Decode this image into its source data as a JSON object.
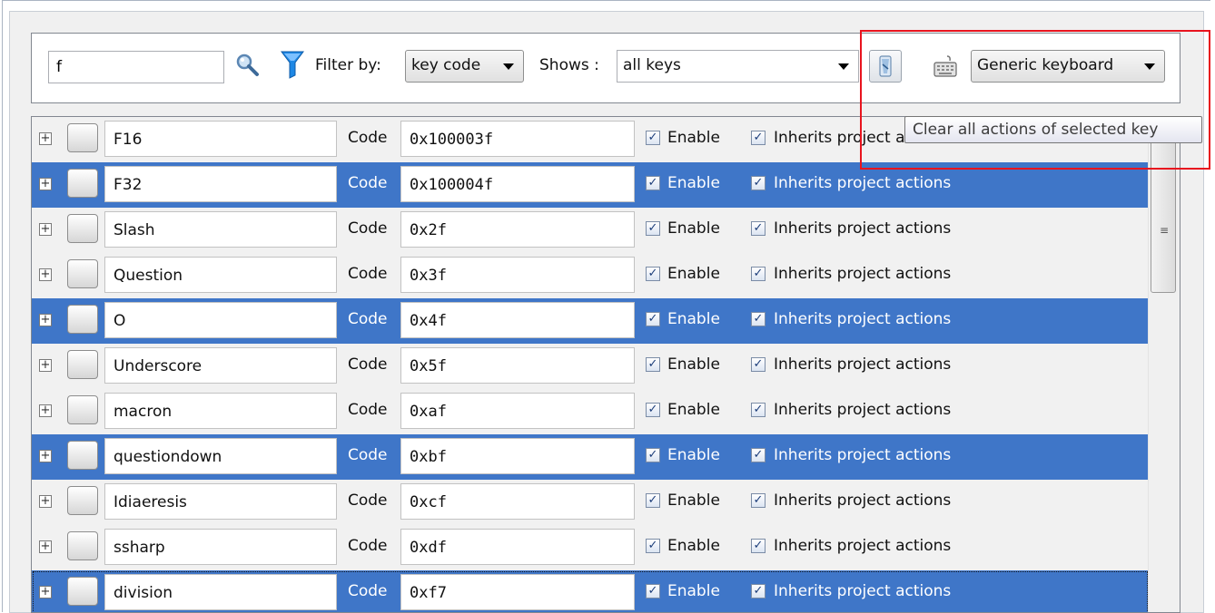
{
  "toolbar": {
    "search_value": "f",
    "filter_label": "Filter by:",
    "filter_selected": "key code",
    "shows_label": "Shows :",
    "shows_selected": "all keys",
    "keyboard_selected": "Generic keyboard"
  },
  "tooltip": {
    "text": "Clear all actions of selected key"
  },
  "rows": [
    {
      "name": "F16",
      "code_label": "Code",
      "code": "0x100003f",
      "enable_label": "Enable",
      "inherit_label": "Inherits project actions",
      "selected": false
    },
    {
      "name": "F32",
      "code_label": "Code",
      "code": "0x100004f",
      "enable_label": "Enable",
      "inherit_label": "Inherits project actions",
      "selected": true
    },
    {
      "name": "Slash",
      "code_label": "Code",
      "code": "0x2f",
      "enable_label": "Enable",
      "inherit_label": "Inherits project actions",
      "selected": false
    },
    {
      "name": "Question",
      "code_label": "Code",
      "code": "0x3f",
      "enable_label": "Enable",
      "inherit_label": "Inherits project actions",
      "selected": false
    },
    {
      "name": "O",
      "code_label": "Code",
      "code": "0x4f",
      "enable_label": "Enable",
      "inherit_label": "Inherits project actions",
      "selected": true
    },
    {
      "name": "Underscore",
      "code_label": "Code",
      "code": "0x5f",
      "enable_label": "Enable",
      "inherit_label": "Inherits project actions",
      "selected": false
    },
    {
      "name": "macron",
      "code_label": "Code",
      "code": "0xaf",
      "enable_label": "Enable",
      "inherit_label": "Inherits project actions",
      "selected": false
    },
    {
      "name": "questiondown",
      "code_label": "Code",
      "code": "0xbf",
      "enable_label": "Enable",
      "inherit_label": "Inherits project actions",
      "selected": true
    },
    {
      "name": "Idiaeresis",
      "code_label": "Code",
      "code": "0xcf",
      "enable_label": "Enable",
      "inherit_label": "Inherits project actions",
      "selected": false
    },
    {
      "name": "ssharp",
      "code_label": "Code",
      "code": "0xdf",
      "enable_label": "Enable",
      "inherit_label": "Inherits project actions",
      "selected": false
    },
    {
      "name": "division",
      "code_label": "Code",
      "code": "0xf7",
      "enable_label": "Enable",
      "inherit_label": "Inherits project actions",
      "selected": true
    }
  ],
  "icons": {
    "search": "search-icon",
    "filter": "filter-funnel-icon",
    "clear": "clear-actions-icon",
    "keyboard": "keyboard-icon",
    "expand": "expand-plus-icon",
    "key": "key-button-icon",
    "scroll_grip": "scroll-grip-icon"
  },
  "colors": {
    "selection": "#3f76c8",
    "highlight": "#e8141e",
    "funnel": "#1e88e5"
  }
}
